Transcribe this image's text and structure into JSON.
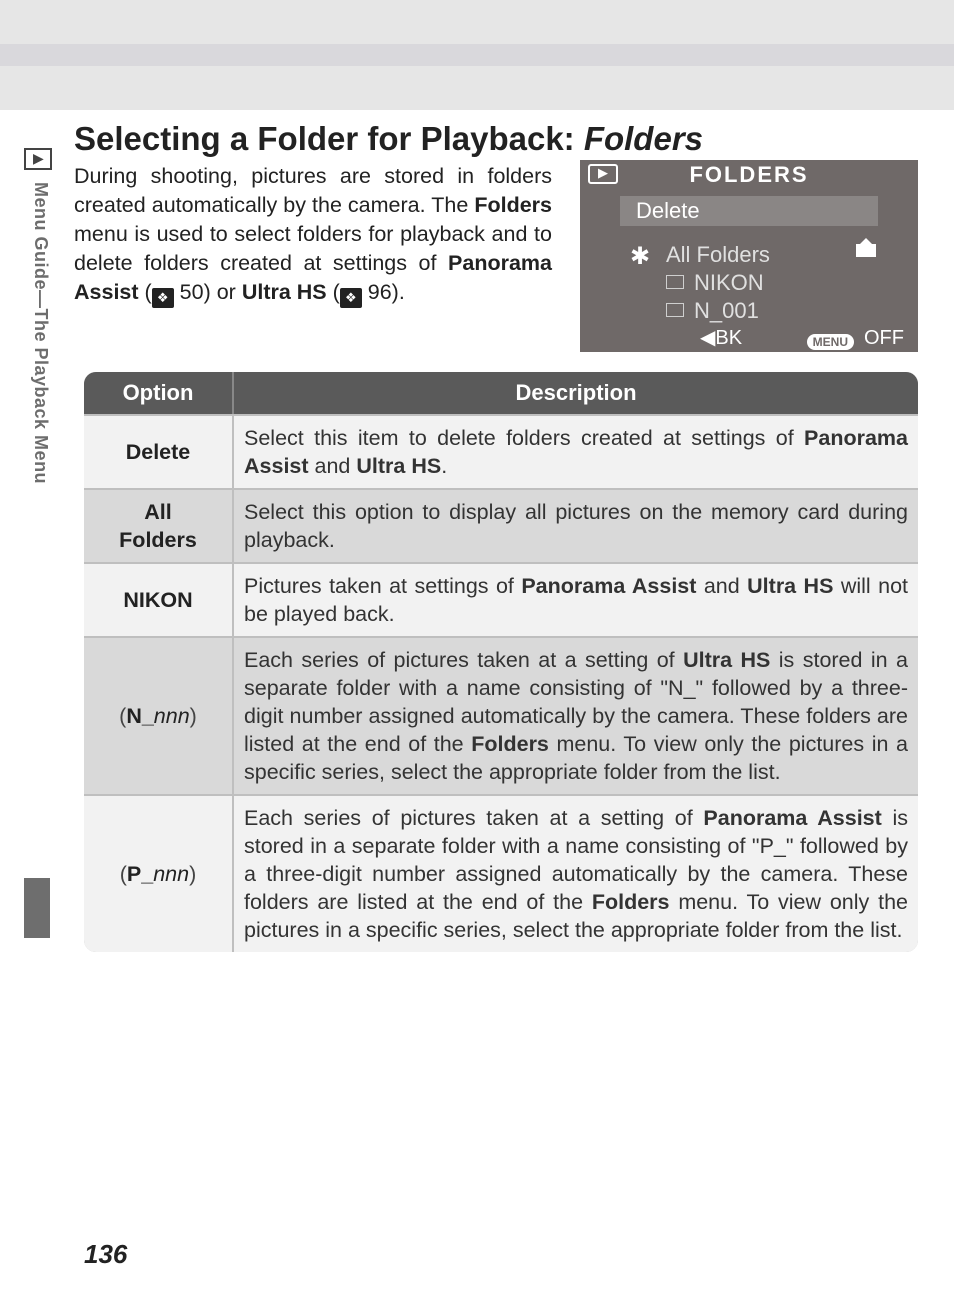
{
  "sidebar_text": "Menu Guide—The Playback Menu",
  "heading": {
    "plain": "Selecting a Folder for Playback: ",
    "ital": "Folders"
  },
  "intro_html": "During shooting, pictures are stored in folders created automatically by the camera.  The <b>Folders</b> menu is used to select folders for playback and to delete folders created at settings of <b>Panorama Assist</b> (<span class='ref-icon'>❖</span> 50) or <b>Ultra HS</b> (<span class='ref-icon'>❖</span> 96).",
  "lcd": {
    "title": "FOLDERS",
    "rows": [
      "Delete",
      "All Folders",
      "NIKON",
      "N_001"
    ],
    "bk": "◀BK",
    "menu": "MENU",
    "off": "OFF"
  },
  "table": {
    "head": {
      "option": "Option",
      "desc": "Description"
    },
    "rows": [
      {
        "option_html": "Delete",
        "desc_html": "Select this item to delete folders created at settings of <b>Panorama Assist</b> and <b>Ultra HS</b>."
      },
      {
        "option_html": "All<br>Folders",
        "desc_html": "Select this option to display all pictures on the memory card during playback."
      },
      {
        "option_html": "NIKON",
        "desc_html": "Pictures taken at settings of <b>Panorama Assist</b> and <b>Ultra HS</b> will not be played back."
      },
      {
        "option_html": "<span class='paren'>(</span>N_<span class='ital'>nnn</span><span class='paren'>)</span>",
        "desc_html": "Each series of pictures taken at a setting of <b>Ultra HS</b> is stored in a separate folder with a name consisting of \"N_\" followed by a three-digit number assigned automatically by the camera.  These folders are listed at the end of the <b>Folders</b> menu.  To view only the pictures in a specific series, select the appropriate folder from the list."
      },
      {
        "option_html": "<span class='paren'>(</span>P_<span class='ital'>nnn</span><span class='paren'>)</span>",
        "desc_html": "Each series of pictures taken at a setting of <b>Panorama Assist</b> is stored in a separate folder with a name consisting of \"P_\" followed by a three-digit number assigned automatically by the camera.  These folders are listed at the end of the <b>Folders</b> menu.  To view only the pictures in a specific series, select the appropriate folder from the list."
      }
    ]
  },
  "page_number": "136"
}
